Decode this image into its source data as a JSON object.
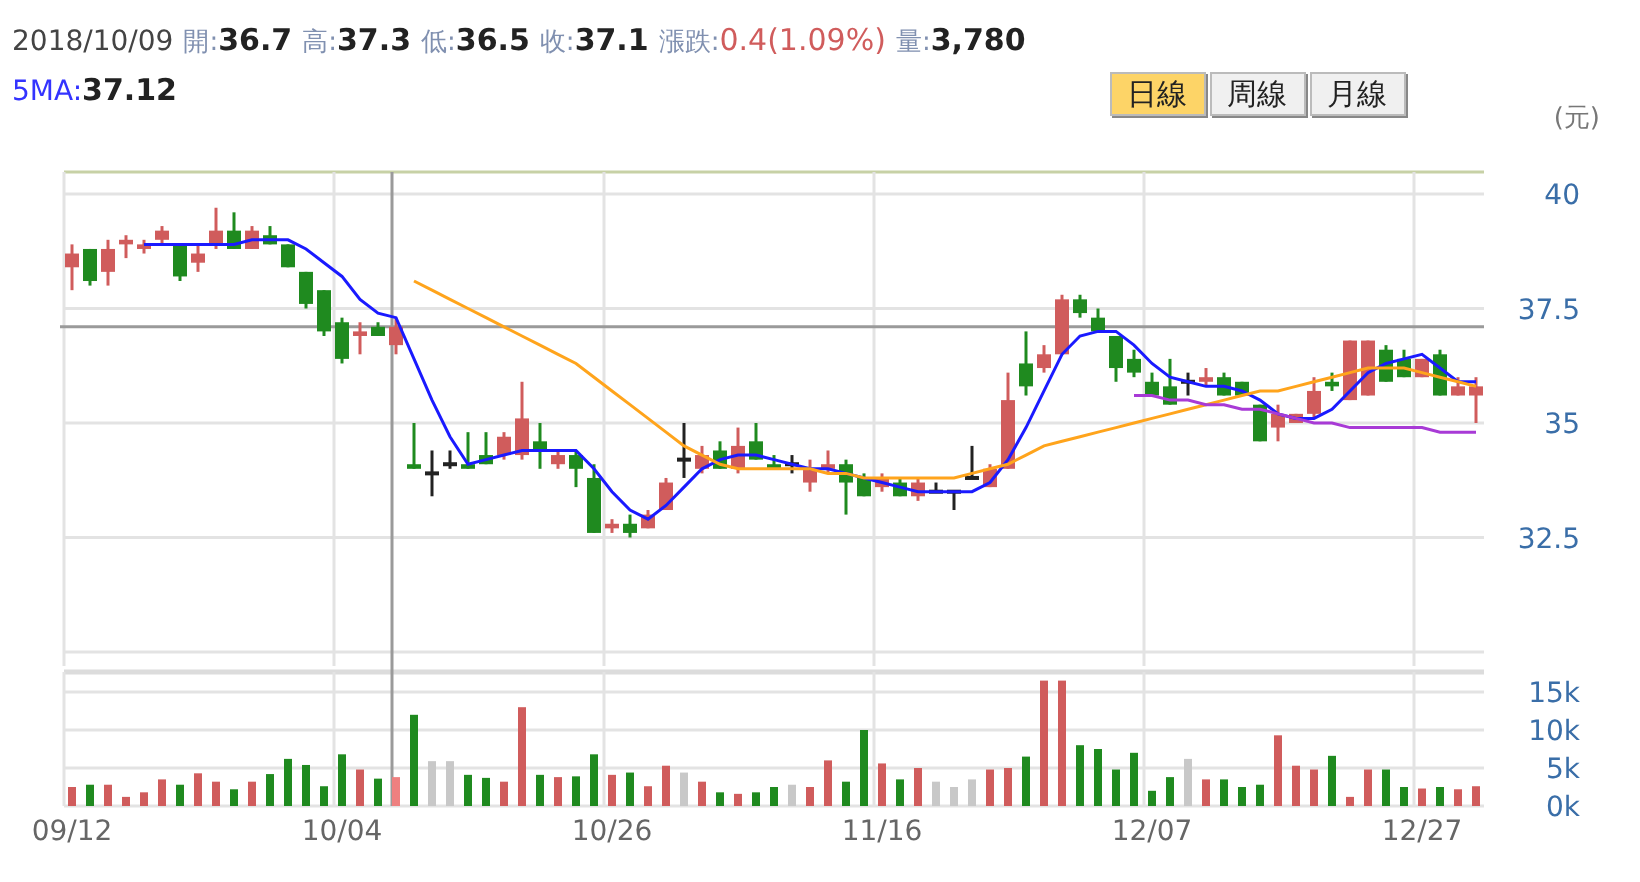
{
  "quote": {
    "date": "2018/10/09",
    "fields": [
      {
        "label": "開:",
        "value": "36.7",
        "kind": "plain"
      },
      {
        "label": "高:",
        "value": "37.3",
        "kind": "plain"
      },
      {
        "label": "低:",
        "value": "36.5",
        "kind": "plain"
      },
      {
        "label": "收:",
        "value": "37.1",
        "kind": "plain"
      },
      {
        "label": "漲跌:",
        "value": "0.4(1.09%)",
        "kind": "change"
      },
      {
        "label": "量:",
        "value": "3,780",
        "kind": "plain"
      }
    ],
    "ma": {
      "label": "5MA:",
      "value": "37.12"
    }
  },
  "period_tabs": [
    {
      "label": "日線",
      "selected": true
    },
    {
      "label": "周線",
      "selected": false
    },
    {
      "label": "月線",
      "selected": false
    }
  ],
  "unit": "(元)",
  "price_chart": {
    "chart_data": {
      "type": "candlestick",
      "grid": true,
      "ylim": [
        30,
        40.5
      ],
      "categories": [
        null,
        null,
        null,
        null,
        null,
        null,
        null,
        null,
        null,
        null,
        null,
        null,
        null,
        null,
        null,
        null,
        null,
        null,
        null,
        null,
        null,
        null,
        null,
        null,
        null,
        null,
        null,
        null,
        null,
        null,
        null,
        null,
        null,
        null,
        null,
        null,
        null,
        null,
        null,
        null,
        null,
        null,
        null,
        null,
        null,
        null,
        null,
        null,
        null,
        null,
        null,
        null,
        null,
        null,
        null,
        null,
        null,
        null,
        null,
        null,
        null,
        null,
        null,
        null,
        null,
        null,
        null,
        null,
        null,
        null,
        null,
        null,
        null,
        null,
        null,
        null,
        null,
        null,
        null
      ],
      "yticks": [
        {
          "value": 32.5,
          "label": "32.5"
        },
        {
          "value": 35,
          "label": "35"
        },
        {
          "value": 37.5,
          "label": "37.5"
        },
        {
          "value": 40,
          "label": "40"
        }
      ],
      "ref_lines": [
        {
          "axis": "y",
          "value": 37.1
        }
      ],
      "ohlc": [
        [
          38.4,
          38.9,
          37.9,
          38.7
        ],
        [
          38.8,
          38.8,
          38.0,
          38.1
        ],
        [
          38.3,
          39.0,
          38.0,
          38.8
        ],
        [
          38.9,
          39.1,
          38.6,
          39.0
        ],
        [
          38.8,
          39.0,
          38.7,
          38.9
        ],
        [
          39.0,
          39.3,
          38.9,
          39.2
        ],
        [
          38.9,
          38.9,
          38.1,
          38.2
        ],
        [
          38.5,
          38.9,
          38.3,
          38.7
        ],
        [
          38.9,
          39.7,
          38.8,
          39.2
        ],
        [
          39.2,
          39.6,
          38.8,
          38.8
        ],
        [
          38.8,
          39.3,
          38.8,
          39.2
        ],
        [
          39.1,
          39.3,
          38.9,
          38.9
        ],
        [
          38.9,
          38.9,
          38.4,
          38.4
        ],
        [
          38.3,
          38.3,
          37.5,
          37.6
        ],
        [
          37.9,
          37.9,
          36.9,
          37.0
        ],
        [
          37.2,
          37.3,
          36.3,
          36.4
        ],
        [
          36.9,
          37.2,
          36.5,
          37.0
        ],
        [
          37.1,
          37.2,
          36.9,
          36.9
        ],
        [
          36.7,
          37.3,
          36.5,
          37.1
        ],
        [
          34.1,
          35.0,
          34.0,
          34.0
        ],
        [
          33.9,
          34.4,
          33.4,
          33.9
        ],
        [
          34.1,
          34.4,
          34.0,
          34.1
        ],
        [
          34.1,
          34.8,
          34.0,
          34.0
        ],
        [
          34.3,
          34.8,
          34.1,
          34.1
        ],
        [
          34.3,
          34.8,
          34.2,
          34.7
        ],
        [
          34.3,
          35.9,
          34.2,
          35.1
        ],
        [
          34.6,
          35.0,
          34.0,
          34.4
        ],
        [
          34.1,
          34.4,
          34.0,
          34.3
        ],
        [
          34.3,
          34.4,
          33.6,
          34.0
        ],
        [
          33.8,
          34.1,
          32.6,
          32.6
        ],
        [
          32.7,
          32.9,
          32.6,
          32.8
        ],
        [
          32.8,
          33.0,
          32.5,
          32.6
        ],
        [
          32.7,
          33.1,
          32.7,
          33.0
        ],
        [
          33.1,
          33.8,
          33.1,
          33.7
        ],
        [
          34.2,
          35.0,
          33.8,
          34.2
        ],
        [
          34.0,
          34.5,
          33.9,
          34.3
        ],
        [
          34.4,
          34.6,
          34.0,
          34.0
        ],
        [
          34.0,
          34.9,
          33.9,
          34.5
        ],
        [
          34.6,
          35.0,
          34.2,
          34.2
        ],
        [
          34.1,
          34.3,
          34.0,
          34.0
        ],
        [
          34.1,
          34.3,
          33.9,
          34.1
        ],
        [
          33.7,
          34.2,
          33.5,
          34.0
        ],
        [
          34.0,
          34.4,
          33.9,
          34.1
        ],
        [
          34.1,
          34.2,
          33.0,
          33.7
        ],
        [
          33.8,
          33.9,
          33.4,
          33.4
        ],
        [
          33.6,
          33.9,
          33.5,
          33.8
        ],
        [
          33.7,
          33.8,
          33.4,
          33.4
        ],
        [
          33.4,
          33.8,
          33.3,
          33.7
        ],
        [
          33.5,
          33.7,
          33.5,
          33.5
        ],
        [
          33.5,
          33.5,
          33.1,
          33.5
        ],
        [
          33.8,
          34.5,
          33.8,
          33.8
        ],
        [
          33.6,
          34.1,
          33.6,
          34.0
        ],
        [
          34.0,
          36.1,
          34.0,
          35.5
        ],
        [
          36.3,
          37.0,
          35.6,
          35.8
        ],
        [
          36.2,
          36.7,
          36.1,
          36.5
        ],
        [
          36.5,
          37.8,
          36.5,
          37.7
        ],
        [
          37.7,
          37.8,
          37.3,
          37.4
        ],
        [
          37.3,
          37.5,
          37.0,
          37.0
        ],
        [
          36.9,
          36.9,
          35.9,
          36.2
        ],
        [
          36.4,
          36.6,
          36.0,
          36.1
        ],
        [
          35.9,
          36.1,
          35.6,
          35.6
        ],
        [
          35.8,
          36.4,
          35.4,
          35.4
        ],
        [
          35.9,
          36.1,
          35.6,
          35.9
        ],
        [
          35.9,
          36.2,
          35.8,
          36.0
        ],
        [
          36.0,
          36.1,
          35.6,
          35.6
        ],
        [
          35.9,
          35.9,
          35.6,
          35.6
        ],
        [
          35.4,
          35.4,
          34.6,
          34.6
        ],
        [
          34.9,
          35.4,
          34.6,
          35.2
        ],
        [
          35.0,
          35.2,
          35.0,
          35.2
        ],
        [
          35.2,
          36.0,
          35.1,
          35.7
        ],
        [
          35.9,
          36.1,
          35.7,
          35.8
        ],
        [
          35.5,
          36.8,
          35.5,
          36.8
        ],
        [
          35.6,
          36.8,
          35.6,
          36.8
        ],
        [
          36.6,
          36.7,
          35.9,
          35.9
        ],
        [
          36.4,
          36.6,
          36.0,
          36.0
        ],
        [
          36.0,
          36.4,
          36.0,
          36.4
        ],
        [
          36.5,
          36.6,
          35.6,
          35.6
        ],
        [
          35.6,
          36.0,
          35.6,
          35.8
        ],
        [
          35.6,
          36.0,
          35.0,
          35.8
        ]
      ],
      "series": [
        {
          "type": "line",
          "color": "#1a1aff",
          "values": [
            null,
            null,
            null,
            null,
            38.9,
            38.9,
            38.9,
            38.9,
            38.9,
            38.9,
            39.0,
            39.0,
            39.0,
            38.8,
            38.5,
            38.2,
            37.7,
            37.4,
            37.3,
            36.4,
            35.5,
            34.7,
            34.1,
            34.2,
            34.3,
            34.4,
            34.4,
            34.4,
            34.4,
            34.0,
            33.5,
            33.1,
            32.9,
            33.2,
            33.6,
            34.0,
            34.2,
            34.3,
            34.3,
            34.2,
            34.1,
            34.0,
            34.0,
            33.9,
            33.8,
            33.7,
            33.6,
            33.5,
            33.5,
            33.5,
            33.5,
            33.7,
            34.2,
            34.9,
            35.7,
            36.5,
            36.9,
            37.0,
            37.0,
            36.7,
            36.3,
            36.0,
            35.9,
            35.8,
            35.8,
            35.7,
            35.5,
            35.2,
            35.1,
            35.1,
            35.3,
            35.7,
            36.1,
            36.3,
            36.4,
            36.5,
            36.2,
            35.9,
            35.9
          ]
        },
        {
          "type": "line",
          "color": "#ffa41c",
          "values": [
            null,
            null,
            null,
            null,
            null,
            null,
            null,
            null,
            null,
            null,
            null,
            null,
            null,
            null,
            null,
            null,
            null,
            null,
            null,
            38.1,
            37.9,
            37.7,
            37.5,
            37.3,
            37.1,
            36.9,
            36.7,
            36.5,
            36.3,
            36.0,
            35.7,
            35.4,
            35.1,
            34.8,
            34.5,
            34.3,
            34.1,
            34.0,
            34.0,
            34.0,
            34.0,
            34.0,
            33.9,
            33.9,
            33.8,
            33.8,
            33.8,
            33.8,
            33.8,
            33.8,
            33.9,
            34.0,
            34.1,
            34.3,
            34.5,
            34.6,
            34.7,
            34.8,
            34.9,
            35.0,
            35.1,
            35.2,
            35.3,
            35.4,
            35.5,
            35.6,
            35.7,
            35.7,
            35.8,
            35.9,
            36.0,
            36.1,
            36.2,
            36.2,
            36.2,
            36.1,
            36.0,
            35.9,
            35.8
          ]
        },
        {
          "type": "line",
          "color": "#a83ad6",
          "values": [
            null,
            null,
            null,
            null,
            null,
            null,
            null,
            null,
            null,
            null,
            null,
            null,
            null,
            null,
            null,
            null,
            null,
            null,
            null,
            null,
            null,
            null,
            null,
            null,
            null,
            null,
            null,
            null,
            null,
            null,
            null,
            null,
            null,
            null,
            null,
            null,
            null,
            null,
            null,
            null,
            null,
            null,
            null,
            null,
            null,
            null,
            null,
            null,
            null,
            null,
            null,
            null,
            null,
            null,
            null,
            null,
            null,
            null,
            null,
            35.6,
            35.6,
            35.5,
            35.5,
            35.4,
            35.4,
            35.3,
            35.3,
            35.2,
            35.1,
            35.0,
            35.0,
            34.9,
            34.9,
            34.9,
            34.9,
            34.9,
            34.8,
            34.8,
            34.8
          ]
        }
      ]
    }
  },
  "volume_chart": {
    "chart_data": {
      "type": "bar",
      "grid": true,
      "ylim": [
        0,
        17
      ],
      "categories": [
        "09/12",
        null,
        null,
        null,
        null,
        null,
        null,
        null,
        null,
        null,
        null,
        null,
        null,
        null,
        null,
        "10/04",
        null,
        null,
        null,
        null,
        null,
        null,
        null,
        null,
        null,
        null,
        null,
        null,
        null,
        null,
        "10/26",
        null,
        null,
        null,
        null,
        null,
        null,
        null,
        null,
        null,
        null,
        null,
        null,
        null,
        null,
        "11/16",
        null,
        null,
        null,
        null,
        null,
        null,
        null,
        null,
        null,
        null,
        null,
        null,
        null,
        null,
        "12/07",
        null,
        null,
        null,
        null,
        null,
        null,
        null,
        null,
        null,
        null,
        null,
        null,
        null,
        null,
        "12/27",
        null,
        null,
        null
      ],
      "yticks": [
        {
          "value": 0,
          "label": "0k"
        },
        {
          "value": 5,
          "label": "5k"
        },
        {
          "value": 10,
          "label": "10k"
        },
        {
          "value": 15,
          "label": "15k"
        }
      ],
      "series": [
        {
          "values": [
            2.5,
            2.8,
            2.8,
            1.2,
            1.8,
            3.5,
            2.8,
            4.3,
            3.2,
            2.2,
            3.2,
            4.2,
            6.2,
            5.4,
            2.6,
            6.8,
            4.8,
            3.6,
            3.8,
            12,
            5.9,
            5.9,
            4.1,
            3.7,
            3.2,
            13,
            4.1,
            3.8,
            3.9,
            6.8,
            4.1,
            4.4,
            2.6,
            5.3,
            4.4,
            3.2,
            1.8,
            1.6,
            1.8,
            2.5,
            2.8,
            2.5,
            6,
            3.2,
            10,
            5.6,
            3.5,
            5,
            3.2,
            2.5,
            3.5,
            4.8,
            5,
            6.5,
            16.5,
            16.5,
            8,
            7.5,
            4.8,
            7,
            2,
            3.8,
            6.2,
            3.5,
            3.5,
            2.5,
            2.8,
            9.3,
            5.3,
            4.8,
            6.6,
            1.2,
            4.8,
            4.8,
            2.5,
            2.3,
            2.5,
            2.2,
            2.6
          ]
        }
      ]
    }
  }
}
